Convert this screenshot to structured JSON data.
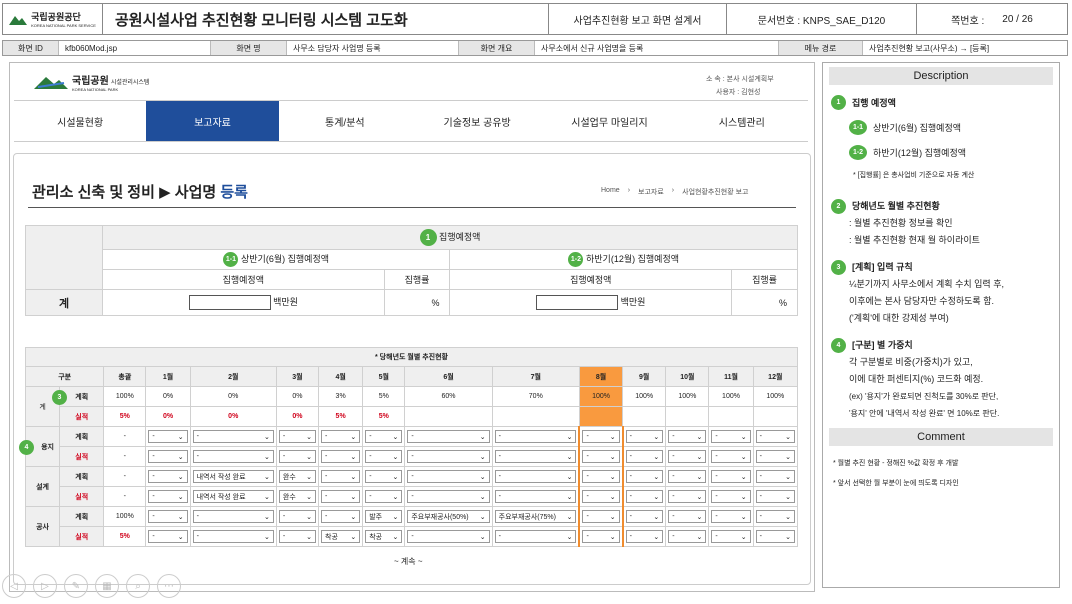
{
  "header": {
    "logo_text": "국립공원공단",
    "logo_sub": "KOREA NATIONAL PARK SERVICE",
    "title": "공원시설사업 추진현황 모니터링 시스템 고도화",
    "doc_title": "사업추진현황 보고 화면 설계서",
    "doc_no": "문서번호 : KNPS_SAE_D120",
    "page_label": "쪽번호 :",
    "page_value": "20 / 26"
  },
  "info": {
    "screen_id_label": "화면 ID",
    "screen_id": "kfb060Mod.jsp",
    "screen_name_label": "화면 명",
    "screen_name": "사무소 담당자 사업명 등록",
    "summary_label": "화면 개요",
    "summary": "사무소에서 신규 사업명을 등록",
    "menu_label": "메뉴 경로",
    "menu": "사업추진현황 보고(사무소) → [등록]"
  },
  "app": {
    "logo_text": "국립공원",
    "logo_sub": "시설관리시스템",
    "logo_eng": "KOREA NATIONAL PARK",
    "dept": "소 속 : 본사 시설계획부",
    "user": "사용자 : 김현성",
    "nav": [
      "시설물현황",
      "보고자료",
      "통계/분석",
      "기술정보 공유방",
      "시설업무 마일리지",
      "시스템관리"
    ],
    "page_title_a": "관리소 신축 및 정비 ▶ 사업명",
    "page_title_b": "등록",
    "breadcrumb": [
      "Home",
      "보고자료",
      "사업현황추진현황 보고"
    ]
  },
  "exec": {
    "badge": "1",
    "title": "집행예정액",
    "h1_badge": "1-1",
    "h1": "상반기(6월) 집행예정액",
    "h2_badge": "1-2",
    "h2": "하반기(12월) 집행예정액",
    "amount": "집행예정액",
    "rate": "집행률",
    "row": "계",
    "unit": "백만원",
    "pct": "%"
  },
  "monthly": {
    "title": "* 당해년도 월별 추진현황",
    "head": [
      "구분",
      "총괄",
      "1월",
      "2월",
      "3월",
      "4월",
      "5월",
      "6월",
      "7월",
      "8월",
      "9월",
      "10월",
      "11월",
      "12월"
    ],
    "plan": "계획",
    "actual": "실적",
    "total": "계",
    "b3": "3",
    "b4": "4",
    "land": "용지",
    "design": "설계",
    "work": "공사",
    "gplan": [
      "100%",
      "0%",
      "0%",
      "0%",
      "3%",
      "5%",
      "60%",
      "70%",
      "100%",
      "100%",
      "100%",
      "100%",
      "100%"
    ],
    "gact": [
      "5%",
      "0%",
      "0%",
      "0%",
      "5%",
      "5%"
    ],
    "dash": "-",
    "d2": "내역서 작성 완료",
    "d3": "완수",
    "w4": "발주",
    "w5a": "착공",
    "w6": "주요부재공사(50%)",
    "w7": "주요부재공사(75%)",
    "w5b": "착공",
    "wplan": "100%",
    "wact": "5%",
    "more": "~ 계속 ~"
  },
  "desc": {
    "title": "Description",
    "i1": "집행 예정액",
    "i11": "상반기(6월) 집행예정액",
    "i12": "하반기(12월) 집행예정액",
    "i1n": "* [집행률] 은 총사업비 기준으로 자동 계산",
    "i2": "당해년도 월별 추진현황",
    "i2a": ": 월별 추진현황 정보를 확인",
    "i2b": ": 월별 추진현황 현재 월 하이라이트",
    "i3": "[계획] 입력 규칙",
    "i3a": "¼분기까지 사무소에서 계획 수치 입력 후,",
    "i3b": "이후에는 본사 담당자만 수정하도록 함.",
    "i3c": "('계획'에 대한 강제성 부여)",
    "i4": "[구분] 별 가중치",
    "i4a": "각 구분별로 비중(가중치)가 있고,",
    "i4b": "이에 대한 퍼센티지(%) 코드화 예정.",
    "i4c": "(ex) '용지'가 완료되면 진척도를 30%로 판단,",
    "i4d": "'용지' 안에 '내역서 작성 완료' 면 10%로 판단.",
    "comment": "Comment",
    "c1": "* 월별 추진 현황 - 정해진 %값 확정 후 개발",
    "c2": "* 앞서 선택한 월 부분이 눈에 띄도록 디자인"
  },
  "colors": {
    "nav_active": "#1f4e9b",
    "badge": "#52b147",
    "highlight": "#f99a3f"
  }
}
